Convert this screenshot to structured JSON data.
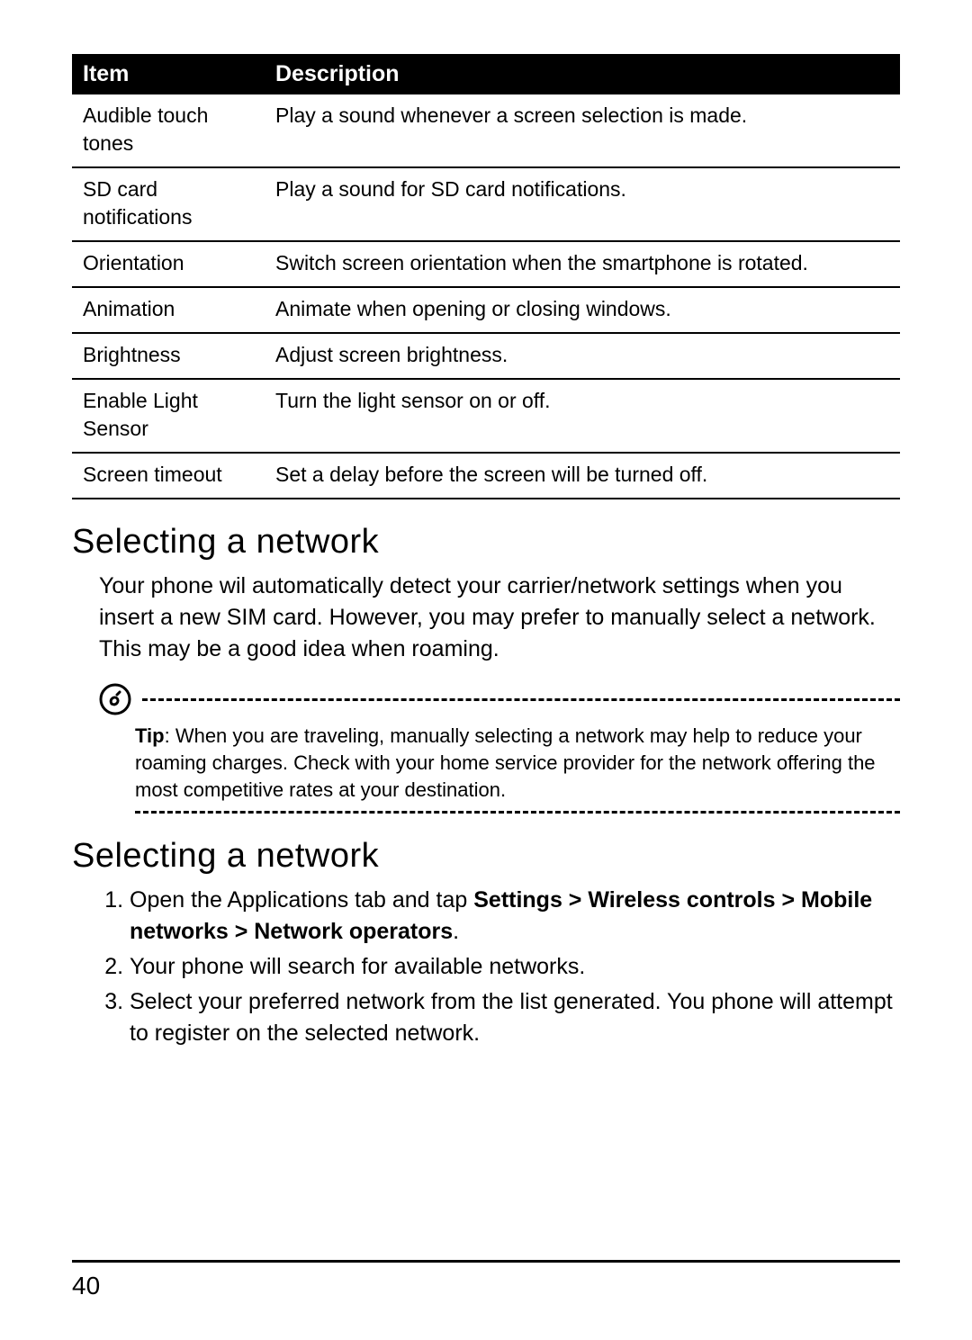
{
  "table": {
    "headers": {
      "item": "Item",
      "desc": "Description"
    },
    "rows": [
      {
        "item": "Audible touch tones",
        "desc": "Play a sound whenever a screen selection is made."
      },
      {
        "item": "SD card notifications",
        "desc": "Play a sound for SD card notifications."
      },
      {
        "item": "Orientation",
        "desc": "Switch screen orientation when the smartphone is rotated."
      },
      {
        "item": "Animation",
        "desc": "Animate when opening or closing windows."
      },
      {
        "item": "Brightness",
        "desc": "Adjust screen brightness."
      },
      {
        "item": "Enable Light Sensor",
        "desc": "Turn the light sensor on or off."
      },
      {
        "item": "Screen timeout",
        "desc": "Set a delay before the screen will be turned off."
      }
    ]
  },
  "heading1": "Selecting a network",
  "intro_paragraph": "Your phone wil automatically detect your carrier/network settings when you insert a new SIM card. However, you may prefer to manually select a network. This may be a good idea when roaming.",
  "tip": {
    "label": "Tip",
    "body": ": When you are traveling, manually selecting a network may help to reduce your roaming charges. Check with your home service provider for the network offering the most competitive rates at your destination."
  },
  "heading2": "Selecting a network",
  "steps": {
    "s1_pre": "Open the Applications tab and tap ",
    "s1_bold": "Settings > Wireless controls > Mobile networks > Network operators",
    "s1_post": ".",
    "s2": "Your phone will search for available networks.",
    "s3": "Select your preferred network from the list generated. You phone will attempt to register on the selected network."
  },
  "page_number": "40"
}
